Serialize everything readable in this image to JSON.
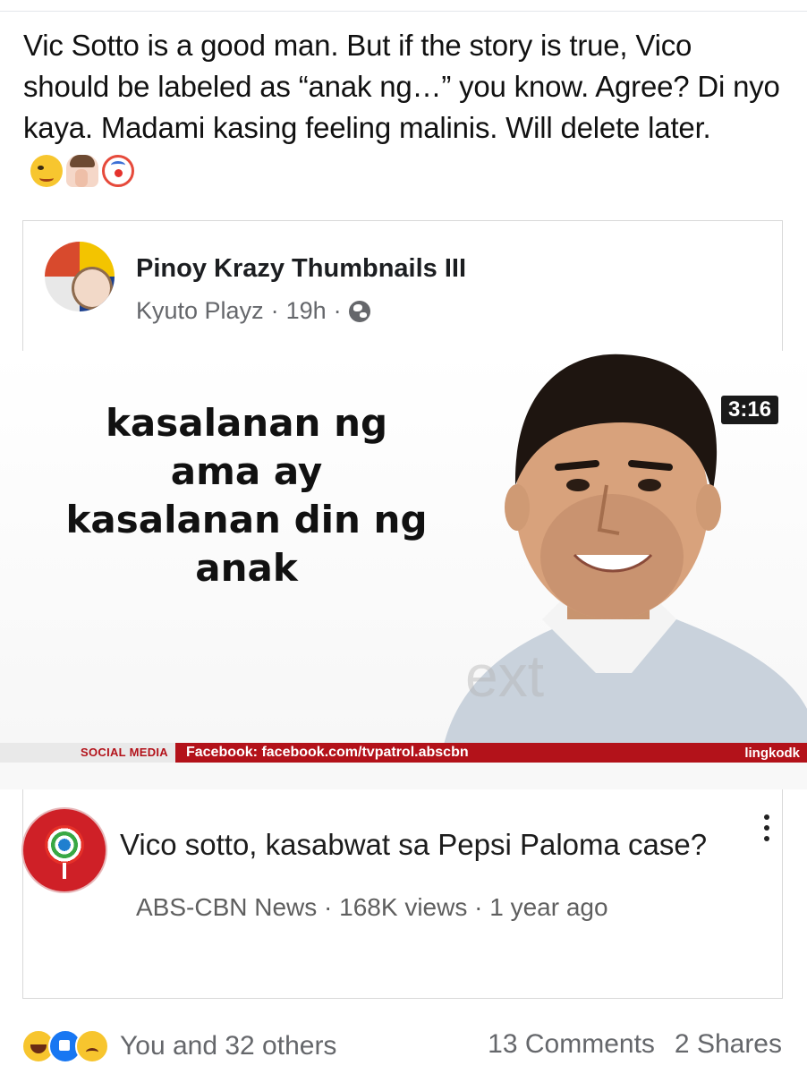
{
  "post": {
    "text": "Vic Sotto is a good man. But if the story is true, Vico should be labeled as “anak ng…” you know. Agree? Di nyo kaya. Madami kasing feeling malinis. Will delete later.",
    "emojis": [
      "woozy-face-icon",
      "man-facepalming-icon",
      "clown-face-icon"
    ]
  },
  "shared_post": {
    "group_name": "Pinoy Krazy Thumbnails III",
    "author": "Kyuto Playz",
    "time": "19h",
    "separator": "·",
    "privacy_icon": "globe-icon"
  },
  "thumbnail": {
    "caption_lines": [
      "kasalanan ng",
      "ama ay",
      "kasalanan din ng",
      "anak"
    ],
    "watermark": "ext",
    "ticker_label": "SOCIAL MEDIA",
    "ticker_text": "Facebook: facebook.com/tvpatrol.abscbn",
    "ticker_right": "lingkodk",
    "duration": "3:16"
  },
  "video": {
    "title": "Vico sotto, kasabwat sa Pepsi Paloma case?",
    "channel": "ABS-CBN News",
    "views": "168K views",
    "age": "1 year ago",
    "separator": "·",
    "channel_logo_text": "ABS-CBN NEWS"
  },
  "footer": {
    "reactions": [
      "haha-reaction-icon",
      "like-reaction-icon",
      "sad-reaction-icon"
    ],
    "reaction_text": "You and 32 others",
    "comments": "13 Comments",
    "shares": "2 Shares"
  },
  "colors": {
    "ticker_red": "#b3121a",
    "facebook_blue": "#1877f2",
    "meta_gray": "#65676b"
  }
}
